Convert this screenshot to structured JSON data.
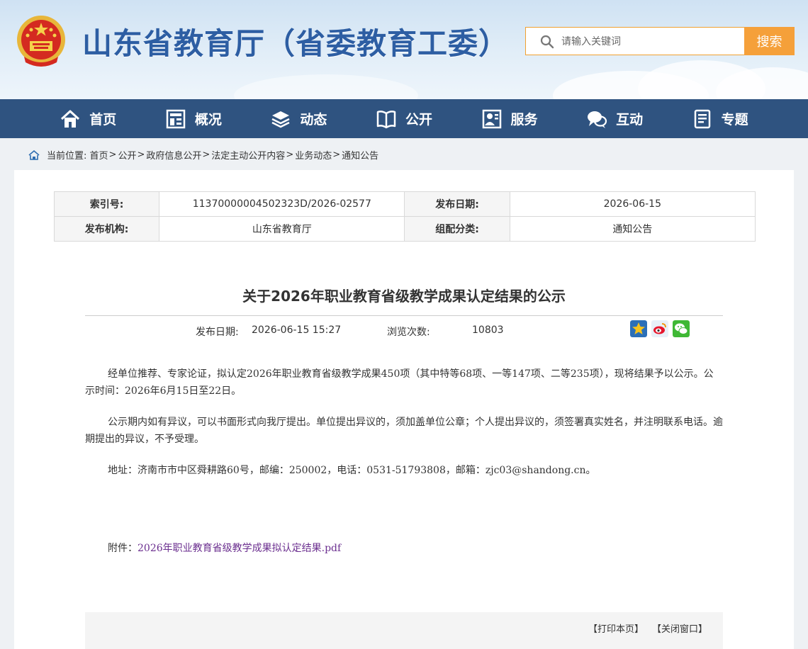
{
  "header": {
    "site_title": "山东省教育厅（省委教育工委）",
    "search_placeholder": "请输入关键词",
    "search_button": "搜索"
  },
  "nav": {
    "items": [
      {
        "label": "首页",
        "icon": "home-icon"
      },
      {
        "label": "概况",
        "icon": "overview-icon"
      },
      {
        "label": "动态",
        "icon": "news-stack-icon"
      },
      {
        "label": "公开",
        "icon": "open-book-icon"
      },
      {
        "label": "服务",
        "icon": "service-icon"
      },
      {
        "label": "互动",
        "icon": "chat-icon"
      },
      {
        "label": "专题",
        "icon": "topic-icon"
      }
    ]
  },
  "breadcrumb": {
    "prefix": "当前位置:",
    "items": [
      "首页",
      "公开",
      "政府信息公开",
      "法定主动公开内容",
      "业务动态",
      "通知公告"
    ],
    "separator": ">"
  },
  "meta": {
    "index_label": "索引号:",
    "index_value": "11370000004502323D/2026-02577",
    "date_label": "发布日期:",
    "date_value": "2026-06-15",
    "org_label": "发布机构:",
    "org_value": "山东省教育厅",
    "category_label": "组配分类:",
    "category_value": "通知公告"
  },
  "article": {
    "title": "关于2026年职业教育省级教学成果认定结果的公示",
    "publish_label": "发布日期:",
    "publish_value": "2026-06-15 15:27",
    "views_label": "浏览次数:",
    "views_value": "10803",
    "paragraphs": [
      "经单位推荐、专家论证，拟认定2026年职业教育省级教学成果450项（其中特等68项、一等147项、二等235项），现将结果予以公示。公示时间：2026年6月15日至22日。",
      "公示期内如有异议，可以书面形式向我厅提出。单位提出异议的，须加盖单位公章；个人提出异议的，须签署真实姓名，并注明联系电话。逾期提出的异议，不予受理。",
      "地址：济南市市中区舜耕路60号，邮编：250002，电话：0531-51793808，邮箱：zjc03@shandong.cn。"
    ],
    "attachment_label": "附件：",
    "attachment_link": "2026年职业教育省级教学成果拟认定结果.pdf"
  },
  "share": [
    {
      "name": "favorite-share-icon",
      "color": "#2b6fb8"
    },
    {
      "name": "weibo-share-icon",
      "color": "#e8f0f8"
    },
    {
      "name": "wechat-share-icon",
      "color": "#3fb835"
    }
  ],
  "footer": {
    "print_label": "【打印本页】",
    "close_label": "【关闭窗口】"
  },
  "colors": {
    "nav_bg": "#2f5380",
    "title_blue": "#2d5ea3",
    "search_orange": "#f5a03a",
    "attachment_link": "#6b2f8f"
  }
}
